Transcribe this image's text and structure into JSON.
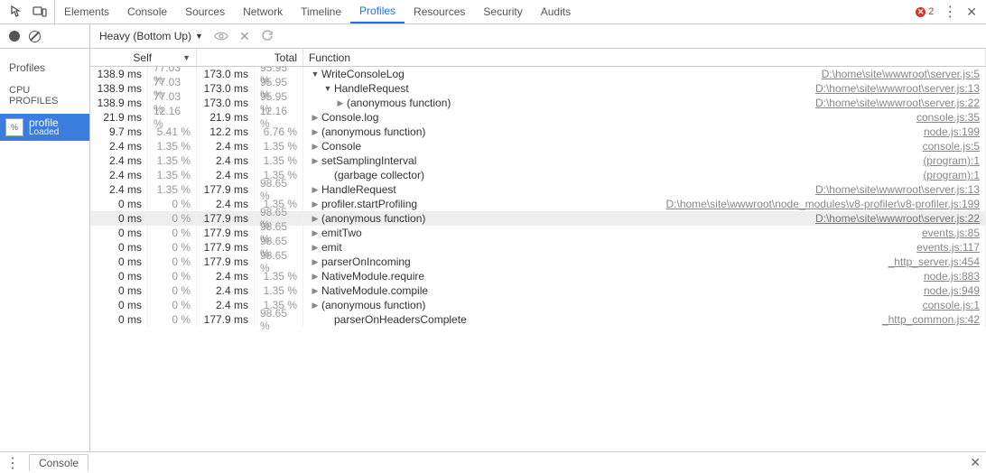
{
  "tabs": [
    "Elements",
    "Console",
    "Sources",
    "Network",
    "Timeline",
    "Profiles",
    "Resources",
    "Security",
    "Audits"
  ],
  "active_tab": 5,
  "error_count": "2",
  "sidebar": {
    "title": "Profiles",
    "section": "CPU PROFILES",
    "item": {
      "name": "profile",
      "status": "Loaded"
    }
  },
  "toolbar": {
    "view_mode": "Heavy (Bottom Up)"
  },
  "columns": {
    "self": "Self",
    "total": "Total",
    "function": "Function"
  },
  "rows": [
    {
      "self_ms": "138.9 ms",
      "self_pct": "77.03 %",
      "total_ms": "173.0 ms",
      "total_pct": "95.95 %",
      "indent": 0,
      "arrow": "open",
      "fn": "WriteConsoleLog",
      "link": "D:\\home\\site\\wwwroot\\server.js:5"
    },
    {
      "self_ms": "138.9 ms",
      "self_pct": "77.03 %",
      "total_ms": "173.0 ms",
      "total_pct": "95.95 %",
      "indent": 1,
      "arrow": "open",
      "fn": "HandleRequest",
      "link": "D:\\home\\site\\wwwroot\\server.js:13"
    },
    {
      "self_ms": "138.9 ms",
      "self_pct": "77.03 %",
      "total_ms": "173.0 ms",
      "total_pct": "95.95 %",
      "indent": 2,
      "arrow": "closed",
      "fn": "(anonymous function)",
      "link": "D:\\home\\site\\wwwroot\\server.js:22"
    },
    {
      "self_ms": "21.9 ms",
      "self_pct": "12.16 %",
      "total_ms": "21.9 ms",
      "total_pct": "12.16 %",
      "indent": 0,
      "arrow": "closed",
      "fn": "Console.log",
      "link": "console.js:35"
    },
    {
      "self_ms": "9.7 ms",
      "self_pct": "5.41 %",
      "total_ms": "12.2 ms",
      "total_pct": "6.76 %",
      "indent": 0,
      "arrow": "closed",
      "fn": "(anonymous function)",
      "link": "node.js:199"
    },
    {
      "self_ms": "2.4 ms",
      "self_pct": "1.35 %",
      "total_ms": "2.4 ms",
      "total_pct": "1.35 %",
      "indent": 0,
      "arrow": "closed",
      "fn": "Console",
      "link": "console.js:5"
    },
    {
      "self_ms": "2.4 ms",
      "self_pct": "1.35 %",
      "total_ms": "2.4 ms",
      "total_pct": "1.35 %",
      "indent": 0,
      "arrow": "closed",
      "fn": "setSamplingInterval",
      "link": "(program):1"
    },
    {
      "self_ms": "2.4 ms",
      "self_pct": "1.35 %",
      "total_ms": "2.4 ms",
      "total_pct": "1.35 %",
      "indent": 1,
      "arrow": "none",
      "fn": "(garbage collector)",
      "link": "(program):1"
    },
    {
      "self_ms": "2.4 ms",
      "self_pct": "1.35 %",
      "total_ms": "177.9 ms",
      "total_pct": "98.65 %",
      "indent": 0,
      "arrow": "closed",
      "fn": "HandleRequest",
      "link": "D:\\home\\site\\wwwroot\\server.js:13"
    },
    {
      "self_ms": "0 ms",
      "self_pct": "0 %",
      "total_ms": "2.4 ms",
      "total_pct": "1.35 %",
      "indent": 0,
      "arrow": "closed",
      "fn": "profiler.startProfiling",
      "link": "D:\\home\\site\\wwwroot\\node_modules\\v8-profiler\\v8-profiler.js:199"
    },
    {
      "self_ms": "0 ms",
      "self_pct": "0 %",
      "total_ms": "177.9 ms",
      "total_pct": "98.65 %",
      "indent": 0,
      "arrow": "closed",
      "fn": "(anonymous function)",
      "link": "D:\\home\\site\\wwwroot\\server.js:22",
      "selected": true
    },
    {
      "self_ms": "0 ms",
      "self_pct": "0 %",
      "total_ms": "177.9 ms",
      "total_pct": "98.65 %",
      "indent": 0,
      "arrow": "closed",
      "fn": "emitTwo",
      "link": "events.js:85"
    },
    {
      "self_ms": "0 ms",
      "self_pct": "0 %",
      "total_ms": "177.9 ms",
      "total_pct": "98.65 %",
      "indent": 0,
      "arrow": "closed",
      "fn": "emit",
      "link": "events.js:117"
    },
    {
      "self_ms": "0 ms",
      "self_pct": "0 %",
      "total_ms": "177.9 ms",
      "total_pct": "98.65 %",
      "indent": 0,
      "arrow": "closed",
      "fn": "parserOnIncoming",
      "link": "_http_server.js:454"
    },
    {
      "self_ms": "0 ms",
      "self_pct": "0 %",
      "total_ms": "2.4 ms",
      "total_pct": "1.35 %",
      "indent": 0,
      "arrow": "closed",
      "fn": "NativeModule.require",
      "link": "node.js:883"
    },
    {
      "self_ms": "0 ms",
      "self_pct": "0 %",
      "total_ms": "2.4 ms",
      "total_pct": "1.35 %",
      "indent": 0,
      "arrow": "closed",
      "fn": "NativeModule.compile",
      "link": "node.js:949"
    },
    {
      "self_ms": "0 ms",
      "self_pct": "0 %",
      "total_ms": "2.4 ms",
      "total_pct": "1.35 %",
      "indent": 0,
      "arrow": "closed",
      "fn": "(anonymous function)",
      "link": "console.js:1"
    },
    {
      "self_ms": "0 ms",
      "self_pct": "0 %",
      "total_ms": "177.9 ms",
      "total_pct": "98.65 %",
      "indent": 1,
      "arrow": "none",
      "fn": "parserOnHeadersComplete",
      "link": "_http_common.js:42"
    }
  ],
  "drawer": {
    "console": "Console"
  }
}
